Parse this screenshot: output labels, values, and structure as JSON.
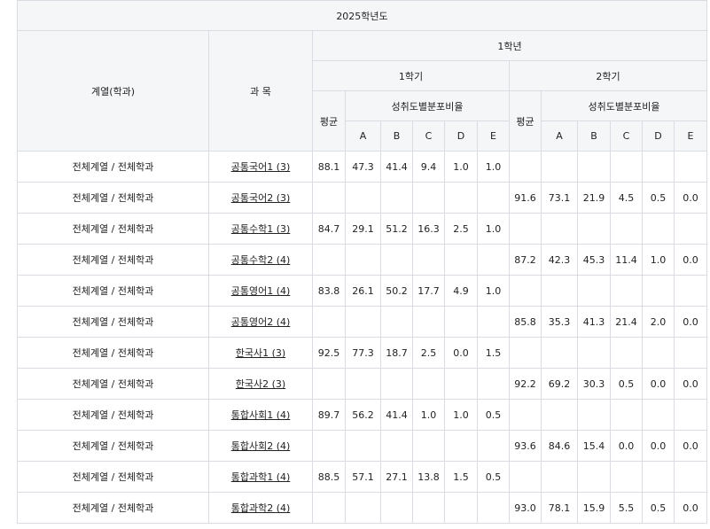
{
  "table": {
    "year_title": "2025학년도",
    "col_track": "계열(학과)",
    "col_subject": "과 목",
    "grade_label": "1학년",
    "semester1_label": "1학기",
    "semester2_label": "2학기",
    "avg_label": "평균",
    "dist_label": "성취도별분포비율",
    "letters": [
      "A",
      "B",
      "C",
      "D",
      "E"
    ],
    "rows": [
      {
        "track": "전체계열 / 전체학과",
        "subject": "공통국어1 (3)",
        "s1": [
          "88.1",
          "47.3",
          "41.4",
          "9.4",
          "1.0",
          "1.0"
        ],
        "s2": [
          "",
          "",
          "",
          "",
          "",
          ""
        ]
      },
      {
        "track": "전체계열 / 전체학과",
        "subject": "공통국어2 (3)",
        "s1": [
          "",
          "",
          "",
          "",
          "",
          ""
        ],
        "s2": [
          "91.6",
          "73.1",
          "21.9",
          "4.5",
          "0.5",
          "0.0"
        ]
      },
      {
        "track": "전체계열 / 전체학과",
        "subject": "공통수학1 (3)",
        "s1": [
          "84.7",
          "29.1",
          "51.2",
          "16.3",
          "2.5",
          "1.0"
        ],
        "s2": [
          "",
          "",
          "",
          "",
          "",
          ""
        ]
      },
      {
        "track": "전체계열 / 전체학과",
        "subject": "공통수학2 (4)",
        "s1": [
          "",
          "",
          "",
          "",
          "",
          ""
        ],
        "s2": [
          "87.2",
          "42.3",
          "45.3",
          "11.4",
          "1.0",
          "0.0"
        ]
      },
      {
        "track": "전체계열 / 전체학과",
        "subject": "공통영어1 (4)",
        "s1": [
          "83.8",
          "26.1",
          "50.2",
          "17.7",
          "4.9",
          "1.0"
        ],
        "s2": [
          "",
          "",
          "",
          "",
          "",
          ""
        ]
      },
      {
        "track": "전체계열 / 전체학과",
        "subject": "공통영어2 (4)",
        "s1": [
          "",
          "",
          "",
          "",
          "",
          ""
        ],
        "s2": [
          "85.8",
          "35.3",
          "41.3",
          "21.4",
          "2.0",
          "0.0"
        ]
      },
      {
        "track": "전체계열 / 전체학과",
        "subject": "한국사1 (3)",
        "s1": [
          "92.5",
          "77.3",
          "18.7",
          "2.5",
          "0.0",
          "1.5"
        ],
        "s2": [
          "",
          "",
          "",
          "",
          "",
          ""
        ]
      },
      {
        "track": "전체계열 / 전체학과",
        "subject": "한국사2 (3)",
        "s1": [
          "",
          "",
          "",
          "",
          "",
          ""
        ],
        "s2": [
          "92.2",
          "69.2",
          "30.3",
          "0.5",
          "0.0",
          "0.0"
        ]
      },
      {
        "track": "전체계열 / 전체학과",
        "subject": "통합사회1 (4)",
        "s1": [
          "89.7",
          "56.2",
          "41.4",
          "1.0",
          "1.0",
          "0.5"
        ],
        "s2": [
          "",
          "",
          "",
          "",
          "",
          ""
        ]
      },
      {
        "track": "전체계열 / 전체학과",
        "subject": "통합사회2 (4)",
        "s1": [
          "",
          "",
          "",
          "",
          "",
          ""
        ],
        "s2": [
          "93.6",
          "84.6",
          "15.4",
          "0.0",
          "0.0",
          "0.0"
        ]
      },
      {
        "track": "전체계열 / 전체학과",
        "subject": "통합과학1 (4)",
        "s1": [
          "88.5",
          "57.1",
          "27.1",
          "13.8",
          "1.5",
          "0.5"
        ],
        "s2": [
          "",
          "",
          "",
          "",
          "",
          ""
        ]
      },
      {
        "track": "전체계열 / 전체학과",
        "subject": "통합과학2 (4)",
        "s1": [
          "",
          "",
          "",
          "",
          "",
          ""
        ],
        "s2": [
          "93.0",
          "78.1",
          "15.9",
          "5.5",
          "0.5",
          "0.0"
        ]
      }
    ]
  }
}
